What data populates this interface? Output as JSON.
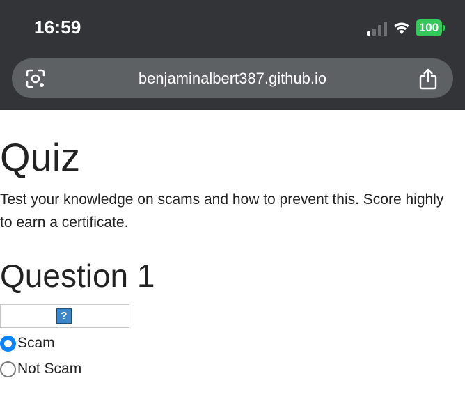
{
  "status_bar": {
    "time": "16:59",
    "battery_level": "100",
    "signal_bars_active": 1,
    "signal_bars_total": 4
  },
  "browser": {
    "url": "benjaminalbert387.github.io"
  },
  "page": {
    "title": "Quiz",
    "intro": "Test your knowledge on scams and how to prevent this. Score highly to earn a certificate.",
    "question": {
      "heading": "Question 1",
      "image_icon": "broken-image-icon",
      "options": [
        {
          "label": "Scam",
          "selected": true
        },
        {
          "label": "Not Scam",
          "selected": false
        }
      ]
    }
  },
  "colors": {
    "chrome_background": "#323437",
    "url_bar_background": "#5e6164",
    "battery": "#34c759",
    "radio_accent": "#0a84ff",
    "text": "#222222"
  }
}
